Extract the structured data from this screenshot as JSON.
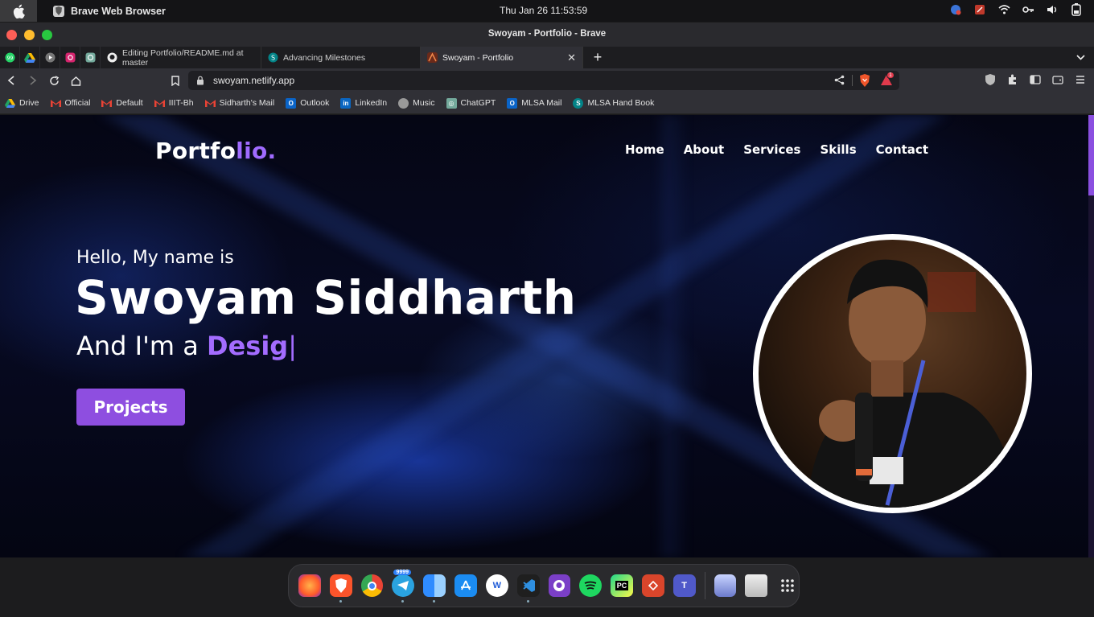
{
  "menubar": {
    "app_name": "Brave Web Browser",
    "clock": "Thu Jan 26   11:53:59",
    "tray_icons": [
      "vpn-badge-icon",
      "remote-icon",
      "wifi-icon",
      "key-icon",
      "volume-icon",
      "battery-icon"
    ]
  },
  "window": {
    "title": "Swoyam - Portfolio - Brave"
  },
  "tabs": {
    "pinned": [
      "whatsapp",
      "google-drive",
      "youtube-music",
      "instagram",
      "chatgpt"
    ],
    "items": [
      {
        "label": "Editing Portfolio/README.md at master"
      },
      {
        "label": "Advancing Milestones"
      },
      {
        "label": "Swoyam - Portfolio",
        "active": true
      }
    ],
    "close_label": "✕",
    "new_tab_label": "+"
  },
  "toolbar": {
    "url": "swoyam.netlify.app",
    "rewards_badge": "1"
  },
  "bookmarks": [
    {
      "label": "Drive",
      "icon": "drive-icon",
      "color": "#f4b400"
    },
    {
      "label": "Official",
      "icon": "gmail-icon",
      "color": "#ea4335"
    },
    {
      "label": "Default",
      "icon": "gmail-icon",
      "color": "#ea4335"
    },
    {
      "label": "IIIT-Bh",
      "icon": "gmail-icon",
      "color": "#ea4335"
    },
    {
      "label": "Sidharth's Mail",
      "icon": "gmail-icon",
      "color": "#ea4335"
    },
    {
      "label": "Outlook",
      "icon": "outlook-icon",
      "color": "#0a64c8"
    },
    {
      "label": "LinkedIn",
      "icon": "linkedin-icon",
      "color": "#0a66c2"
    },
    {
      "label": "Music",
      "icon": "music-icon",
      "color": "#888888"
    },
    {
      "label": "ChatGPT",
      "icon": "chatgpt-icon",
      "color": "#10a37f"
    },
    {
      "label": "MLSA Mail",
      "icon": "outlook-icon",
      "color": "#0a64c8"
    },
    {
      "label": "MLSA Hand Book",
      "icon": "sharepoint-icon",
      "color": "#038387"
    }
  ],
  "site": {
    "logo_main": "Portfo",
    "logo_accent": "lio.",
    "nav": [
      "Home",
      "About",
      "Services",
      "Skills",
      "Contact"
    ],
    "greeting": "Hello, My name is",
    "name": "Swoyam Siddharth",
    "typing_prefix": "And I'm a ",
    "typing_text": "Desig",
    "typing_caret": "|",
    "projects_button": "Projects",
    "accent_color": "#9b5cf0"
  },
  "dock": {
    "apps": [
      "firefox",
      "brave",
      "chrome",
      "telegram",
      "finder",
      "app-store",
      "wps",
      "vscode",
      "github-desktop",
      "spotify",
      "pycharm",
      "anydesk",
      "teams",
      "disk-utility",
      "trash",
      "app-grid"
    ],
    "telegram_badge": "9999"
  }
}
